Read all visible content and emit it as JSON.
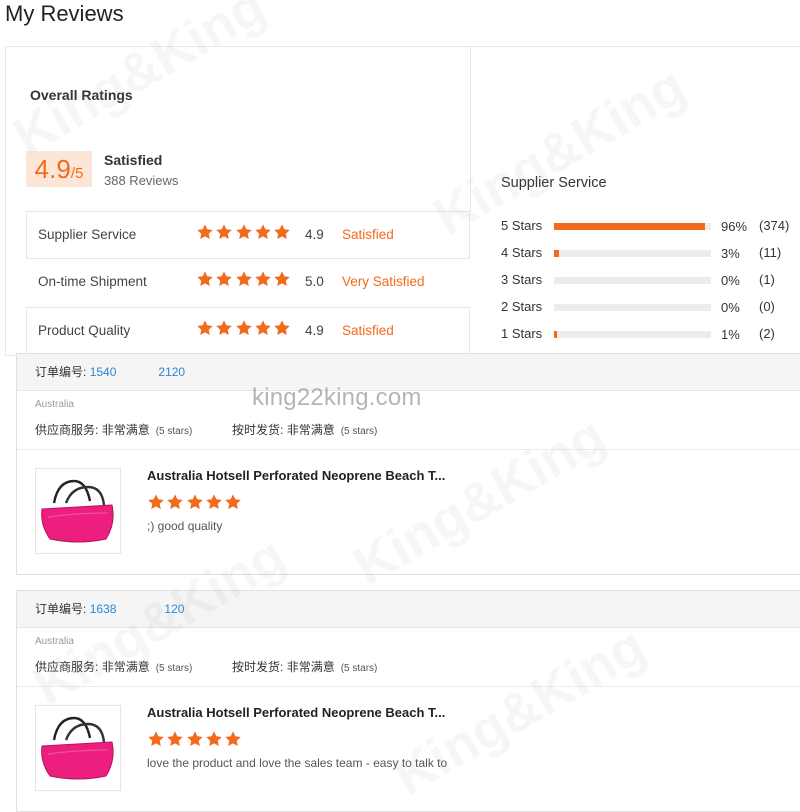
{
  "page": {
    "title": "My Reviews"
  },
  "overall": {
    "label": "Overall Ratings",
    "score": "4.9",
    "score_denominator": "/5",
    "status": "Satisfied",
    "review_count": "388 Reviews",
    "star_color": "#f26b1d",
    "rows": [
      {
        "label": "Supplier Service",
        "stars": 5,
        "value": "4.9",
        "status": "Satisfied"
      },
      {
        "label": "On-time Shipment",
        "stars": 5,
        "value": "5.0",
        "status": "Very Satisfied"
      },
      {
        "label": "Product Quality",
        "stars": 5,
        "value": "4.9",
        "status": "Satisfied"
      }
    ]
  },
  "distribution": {
    "title": "Supplier Service",
    "rows": [
      {
        "label": "5 Stars",
        "fraction": 0.96,
        "percent": "96%",
        "count": "(374)"
      },
      {
        "label": "4 Stars",
        "fraction": 0.03,
        "percent": "3%",
        "count": "(11)"
      },
      {
        "label": "3 Stars",
        "fraction": 0.0,
        "percent": "0%",
        "count": "(1)"
      },
      {
        "label": "2 Stars",
        "fraction": 0.0,
        "percent": "0%",
        "count": "(0)"
      },
      {
        "label": "1 Stars",
        "fraction": 0.01,
        "percent": "1%",
        "count": "(2)"
      }
    ]
  },
  "watermark": {
    "text": "king22king.com",
    "brand": "King&King"
  },
  "orders": [
    {
      "order_label": "订单编号:",
      "order_no_start": "1540",
      "order_no_end": "2120",
      "country": "Australia",
      "service_label": "供应商服务:",
      "service_value": "非常满意",
      "service_stars": "(5 stars)",
      "ship_label": "按时发货:",
      "ship_value": "非常满意",
      "ship_stars": "(5 stars)",
      "product_title": "Australia Hotsell Perforated Neoprene Beach T...",
      "stars": 5,
      "comment": ";) good quality"
    },
    {
      "order_label": "订单编号:",
      "order_no_start": "1638",
      "order_no_end": "120",
      "country": "Australia",
      "service_label": "供应商服务:",
      "service_value": "非常满意",
      "service_stars": "(5 stars)",
      "ship_label": "按时发货:",
      "ship_value": "非常满意",
      "ship_stars": "(5 stars)",
      "product_title": "Australia Hotsell Perforated Neoprene Beach T...",
      "stars": 5,
      "comment": "love the product  and love the sales team - easy to talk to"
    }
  ]
}
